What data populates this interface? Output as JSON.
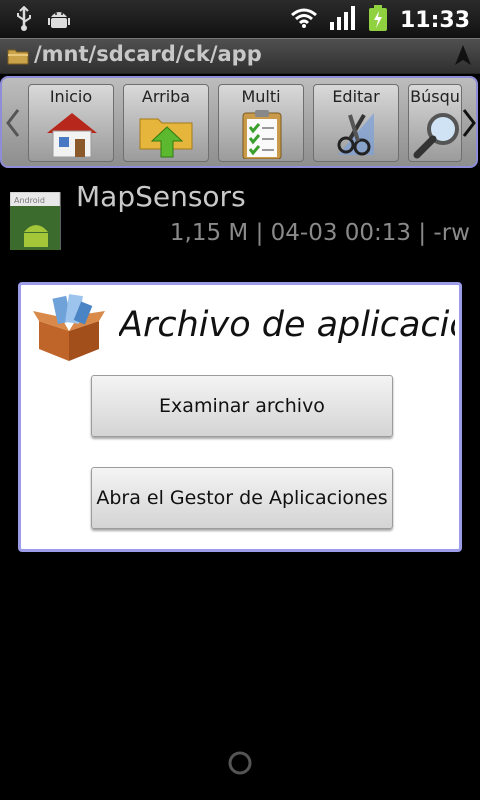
{
  "status_bar": {
    "time": "11:33",
    "icons": [
      "usb-icon",
      "android-debug-icon",
      "wifi-icon",
      "signal-icon",
      "battery-charging-icon"
    ]
  },
  "path_bar": {
    "path": "/mnt/sdcard/ck/app",
    "icons": [
      "folder-icon",
      "navigation-arrow-icon"
    ]
  },
  "toolbar": {
    "items": [
      {
        "label": "Inicio",
        "icon": "home-icon"
      },
      {
        "label": "Arriba",
        "icon": "folder-up-icon"
      },
      {
        "label": "Multi",
        "icon": "clipboard-checklist-icon"
      },
      {
        "label": "Editar",
        "icon": "scissors-icon"
      },
      {
        "label": "Búsqu",
        "icon": "magnifier-icon"
      }
    ],
    "colors": {
      "border": "#8f8cd8"
    }
  },
  "file": {
    "name": "MapSensors",
    "meta": "1,15 M | 04-03 00:13 | -rw",
    "thumb_label": "Android"
  },
  "dialog": {
    "title": "Archivo de aplicación",
    "buttons": {
      "examine": "Examinar archivo",
      "open_manager": "Abra el Gestor de Aplicaciones"
    },
    "colors": {
      "border": "#9c9ce8"
    }
  }
}
